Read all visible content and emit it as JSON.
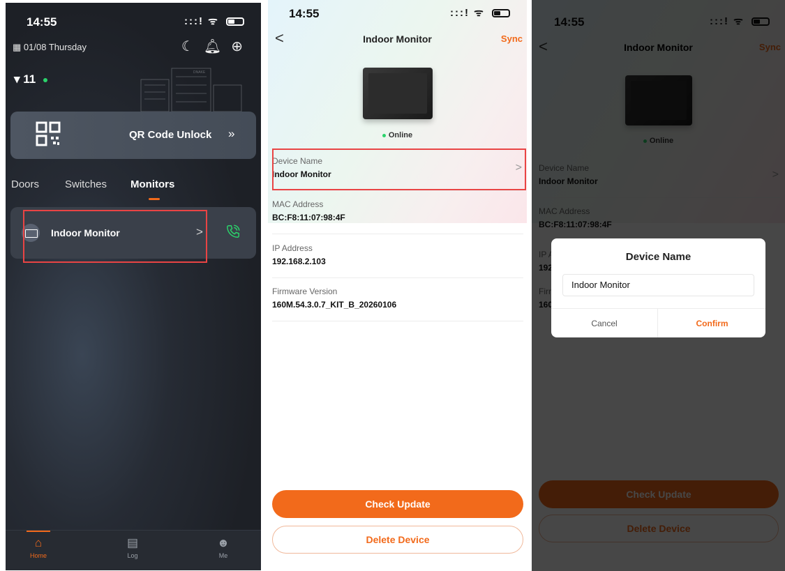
{
  "colors": {
    "accent": "#f26a1b",
    "online": "#2bd36b",
    "call": "#2bd36b",
    "highlight": "#e94444"
  },
  "home": {
    "status_bar": {
      "time": "14:55",
      "signal": ":::!"
    },
    "date": "01/08 Thursday",
    "community": "11",
    "building_logo": "DNAKE",
    "qr_unlock": {
      "label": "QR Code Unlock",
      "arrow": "»"
    },
    "tabs": [
      "Doors",
      "Switches",
      "Monitors"
    ],
    "device": {
      "name": "Indoor Monitor",
      "chevron": ">"
    },
    "tabbar": [
      "Home",
      "Log",
      "Me"
    ]
  },
  "detail": {
    "status_bar": {
      "time": "14:55",
      "signal": ":::!"
    },
    "nav": {
      "back": "<",
      "title": "Indoor Monitor",
      "sync": "Sync"
    },
    "status": "Online",
    "fields": [
      {
        "label": "Device Name",
        "value": "Indoor Monitor"
      },
      {
        "label": "MAC Address",
        "value": "BC:F8:11:07:98:4F"
      },
      {
        "label": "IP Address",
        "value": "192.168.2.103"
      },
      {
        "label": "Firmware Version",
        "value": "160M.54.3.0.7_KIT_B_20260106"
      }
    ],
    "check_update": "Check Update",
    "delete_device": "Delete Device"
  },
  "dialog": {
    "title": "Device Name",
    "input_value": "Indoor Monitor",
    "cancel": "Cancel",
    "confirm": "Confirm"
  }
}
